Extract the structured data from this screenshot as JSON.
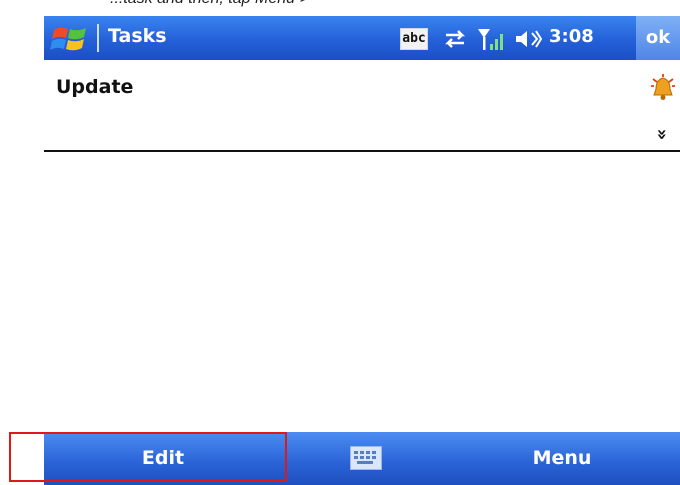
{
  "caption": {
    "text": "...task and then, tap Menu >"
  },
  "titlebar": {
    "title": "Tasks",
    "icons": [
      "windows-start-icon",
      "abc-input-icon",
      "sync-icon",
      "signal-icon",
      "volume-icon"
    ],
    "abc_label": "abc",
    "time": "3:08",
    "ok_label": "ok",
    "colors": {
      "bar": "#2460d8",
      "text": "#ffffff"
    }
  },
  "task": {
    "subject": "Update",
    "reminder_icon": "alarm-bell-icon",
    "expand_icon": "double-chevron-down-icon",
    "expand_glyph": "»"
  },
  "menubar": {
    "left_label": "Edit",
    "right_label": "Menu",
    "center_icon": "keyboard-icon",
    "colors": {
      "bar": "#2a62d6",
      "highlight": "#e01818"
    }
  }
}
